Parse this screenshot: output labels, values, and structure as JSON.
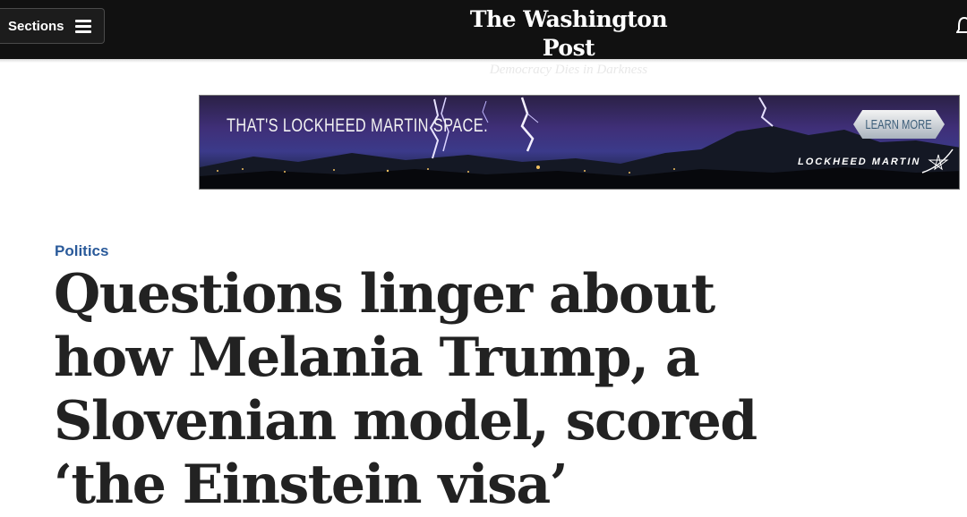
{
  "header": {
    "sections_label": "Sections",
    "logo_name": "The Washington Post",
    "logo_tagline": "Democracy Dies in Darkness"
  },
  "ad": {
    "headline": "THAT'S LOCKHEED MARTIN SPACE.",
    "cta_label": "LEARN MORE",
    "brand": "LOCKHEED MARTIN"
  },
  "article": {
    "kicker": "Politics",
    "headline": "Questions linger about how Melania Trump, a Slovenian model, scored ‘the Einstein visa’"
  },
  "icons": {
    "menu": "hamburger-icon",
    "notifications": "bell-icon",
    "brand": "star-icon"
  },
  "colors": {
    "topbar": "#111111",
    "kicker": "#2a5a9a",
    "headline": "#222222"
  }
}
